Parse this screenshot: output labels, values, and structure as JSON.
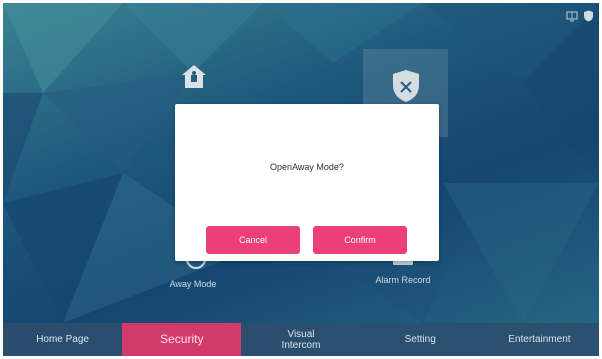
{
  "status_bar": {
    "icons": [
      "screen-icon",
      "shield-icon"
    ]
  },
  "tiles": {
    "home_mode": {
      "icon": "home-icon",
      "label": ""
    },
    "disarm": {
      "icon": "shield-x-icon",
      "label": ""
    },
    "away_mode": {
      "icon": "away-icon",
      "label": "Away Mode"
    },
    "alarm_record": {
      "icon": "record-icon",
      "label": "Alarm Record"
    }
  },
  "dialog": {
    "message": "OpenAway Mode?",
    "cancel_label": "Cancel",
    "confirm_label": "Confirm"
  },
  "nav": {
    "items": [
      {
        "label": "Home Page",
        "active": false
      },
      {
        "label": "Security",
        "active": true
      },
      {
        "label": "Visual\nIntercom",
        "active": false
      },
      {
        "label": "Setting",
        "active": false
      },
      {
        "label": "Entertainment",
        "active": false
      }
    ]
  },
  "colors": {
    "accent": "#ea3f78",
    "nav_active": "#d13a6b",
    "nav_bar": "#2d4e6e",
    "background": "#1f5c82"
  }
}
